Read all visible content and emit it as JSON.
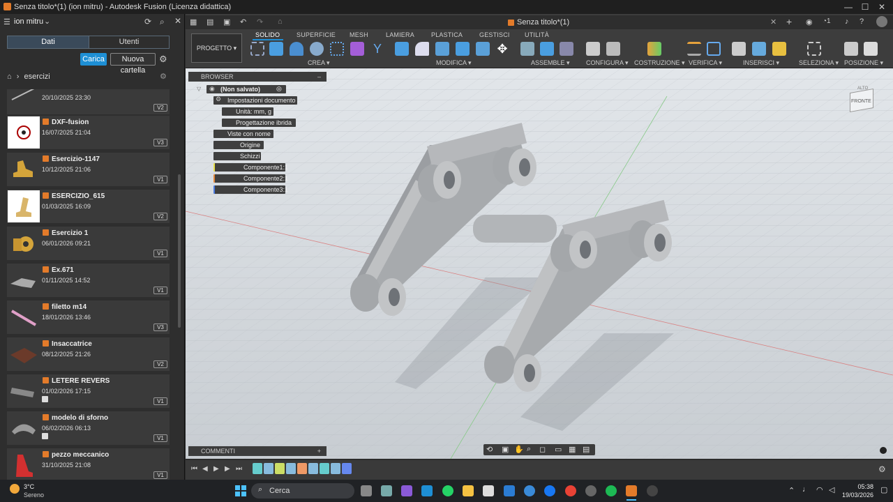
{
  "window": {
    "title": "Senza titolo*(1) (ion mitru) - Autodesk Fusion (Licenza didattica)"
  },
  "account": {
    "user": "ion mitru"
  },
  "left_panel": {
    "tabs": [
      "Dati",
      "Utenti"
    ],
    "buttons": {
      "upload": "Carica",
      "new_folder": "Nuova cartella"
    },
    "breadcrumb": "esercizi",
    "files": [
      {
        "name": "",
        "date": "20/10/2025 23:30",
        "version": "V2"
      },
      {
        "name": "DXF-fusion",
        "date": "16/07/2025 21:04",
        "version": "V3"
      },
      {
        "name": "Esercizio-1147",
        "date": "10/12/2025 21:06",
        "version": "V1"
      },
      {
        "name": "ESERCIZIO_615",
        "date": "01/03/2025 16:09",
        "version": "V2"
      },
      {
        "name": "Esercizio 1",
        "date": "06/01/2026 09:21",
        "version": "V1"
      },
      {
        "name": "Ex.671",
        "date": "01/11/2025 14:52",
        "version": "V1"
      },
      {
        "name": "filetto m14",
        "date": "18/01/2026 13:46",
        "version": "V3"
      },
      {
        "name": "Insaccatrice",
        "date": "08/12/2025 21:26",
        "version": "V2"
      },
      {
        "name": "LETERE REVERS",
        "date": "01/02/2026 17:15",
        "version": "V1"
      },
      {
        "name": "modelo di sforno",
        "date": "06/02/2026 06:13",
        "version": "V1"
      },
      {
        "name": "pezzo meccanico",
        "date": "31/10/2025 21:08",
        "version": "V1"
      }
    ]
  },
  "document_tab": "Senza titolo*(1)",
  "toolbar": {
    "workspace": "PROGETTO",
    "tabs": [
      "SOLIDO",
      "SUPERFICIE",
      "MESH",
      "LAMIERA",
      "PLASTICA",
      "GESTISCI",
      "UTILITÀ"
    ],
    "groups": [
      "CREA",
      "MODIFICA",
      "ASSEMBLE",
      "CONFIGURA",
      "COSTRUZIONE",
      "VERIFICA",
      "INSERISCI",
      "SELEZIONA",
      "POSIZIONE"
    ]
  },
  "browser": {
    "title": "BROWSER",
    "root": "(Non salvato)",
    "nodes": [
      "Impostazioni documento",
      "Unità: mm, g",
      "Progettazione ibrida",
      "Viste con nome",
      "Origine",
      "Schizzi",
      "Componente1:1",
      "Componente2:1",
      "Componente3:1"
    ]
  },
  "viewcube": {
    "front": "FRONTE",
    "top": "ALTO"
  },
  "comments": {
    "label": "COMMENTI"
  },
  "taskbar": {
    "weather_temp": "3°C",
    "weather_text": "Sereno",
    "search": "Cerca",
    "time": "05:38",
    "date": "19/03/2026"
  },
  "colors": {
    "accent": "#1e8fd5",
    "fusion_orange": "#e37b2a",
    "viewport_top": "#e2e6ea"
  }
}
